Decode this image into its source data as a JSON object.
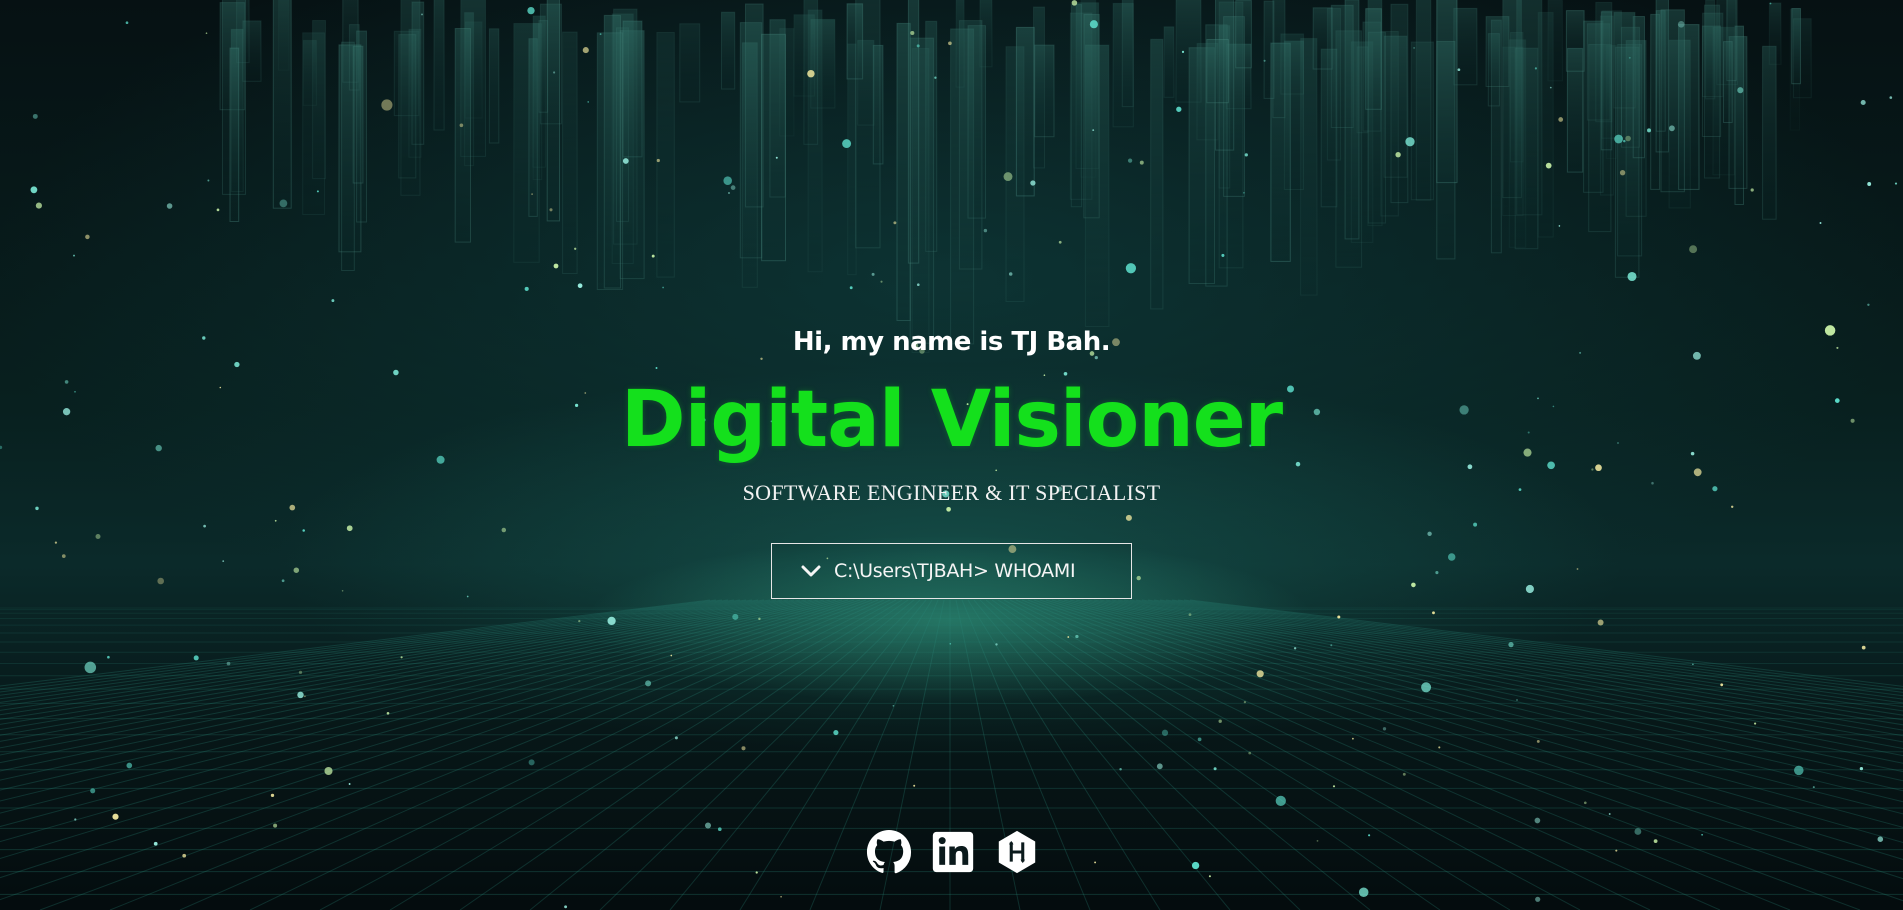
{
  "hero": {
    "greeting": "Hi, my name is TJ Bah.",
    "title": "Digital Visioner",
    "subtitle": "SOFTWARE ENGINEER & IT SPECIALIST",
    "cta": {
      "label": "C:\\Users\\TJBAH> WHOAMI",
      "icon": "chevron-down-icon"
    }
  },
  "socials": [
    {
      "name": "GitHub",
      "icon": "github-icon"
    },
    {
      "name": "LinkedIn",
      "icon": "linkedin-icon"
    },
    {
      "name": "HackerRank",
      "icon": "hackerrank-icon"
    }
  ],
  "colors": {
    "accent": "#14e01c",
    "text": "#ffffff",
    "background": "#061113",
    "glow": "#46d2aa"
  }
}
